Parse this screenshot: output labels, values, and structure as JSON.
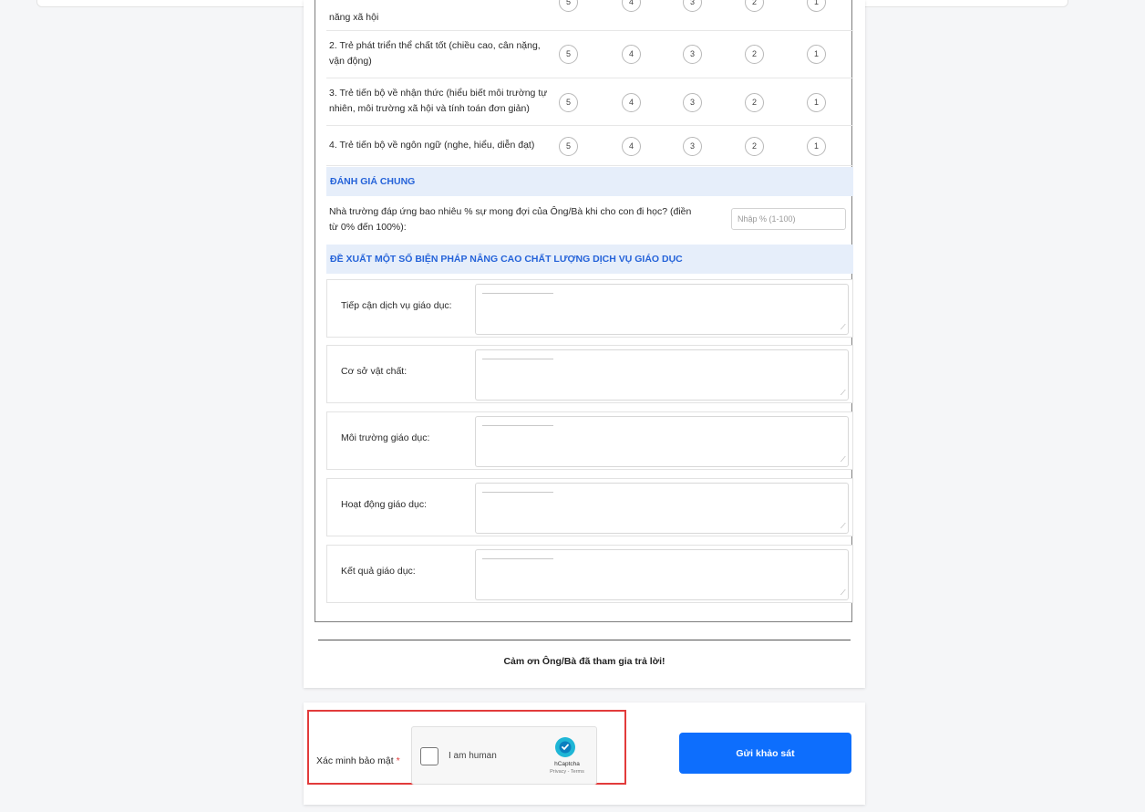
{
  "ratings": {
    "scale": [
      "5",
      "4",
      "3",
      "2",
      "1"
    ],
    "items": [
      {
        "text": "năng xã hội"
      },
      {
        "text": "2. Trẻ phát triển thể chất tốt (chiều cao, cân nặng, vận động)"
      },
      {
        "text": "3. Trẻ tiến bộ về nhận thức (hiểu biết môi trường tự nhiên, môi trường xã hội và tính toán đơn giản)"
      },
      {
        "text": "4. Trẻ tiến bộ về ngôn ngữ (nghe, hiểu, diễn đạt)"
      }
    ]
  },
  "general": {
    "header": "ĐÁNH GIÁ CHUNG",
    "question": "Nhà trường đáp ứng bao nhiêu % sự mong đợi của Ông/Bà khi cho con đi học? (điền từ 0% đến 100%):",
    "placeholder": "Nhập % (1-100)"
  },
  "suggestions": {
    "header": "ĐỀ XUẤT MỘT SỐ BIỆN PHÁP NÂNG CAO CHẤT LƯỢNG DỊCH VỤ GIÁO DỤC",
    "items": [
      {
        "label": "Tiếp cận dịch vụ giáo dục:"
      },
      {
        "label": "Cơ sở vật chất:"
      },
      {
        "label": "Môi trường giáo dục:"
      },
      {
        "label": "Hoạt động giáo dục:"
      },
      {
        "label": "Kết quả giáo dục:"
      }
    ]
  },
  "thanks": "Cảm ơn Ông/Bà đã tham gia trả lời!",
  "verify": {
    "label": "Xác minh bảo mật",
    "required_mark": "*",
    "captcha_label": "I am human",
    "captcha_brand": "hCaptcha",
    "captcha_links": "Privacy - Terms"
  },
  "submit_label": "Gửi khảo sát",
  "colors": {
    "accent": "#0d6efd",
    "section_bg": "#e6eefa",
    "section_text": "#2563d9",
    "highlight_border": "#e23b3b"
  }
}
